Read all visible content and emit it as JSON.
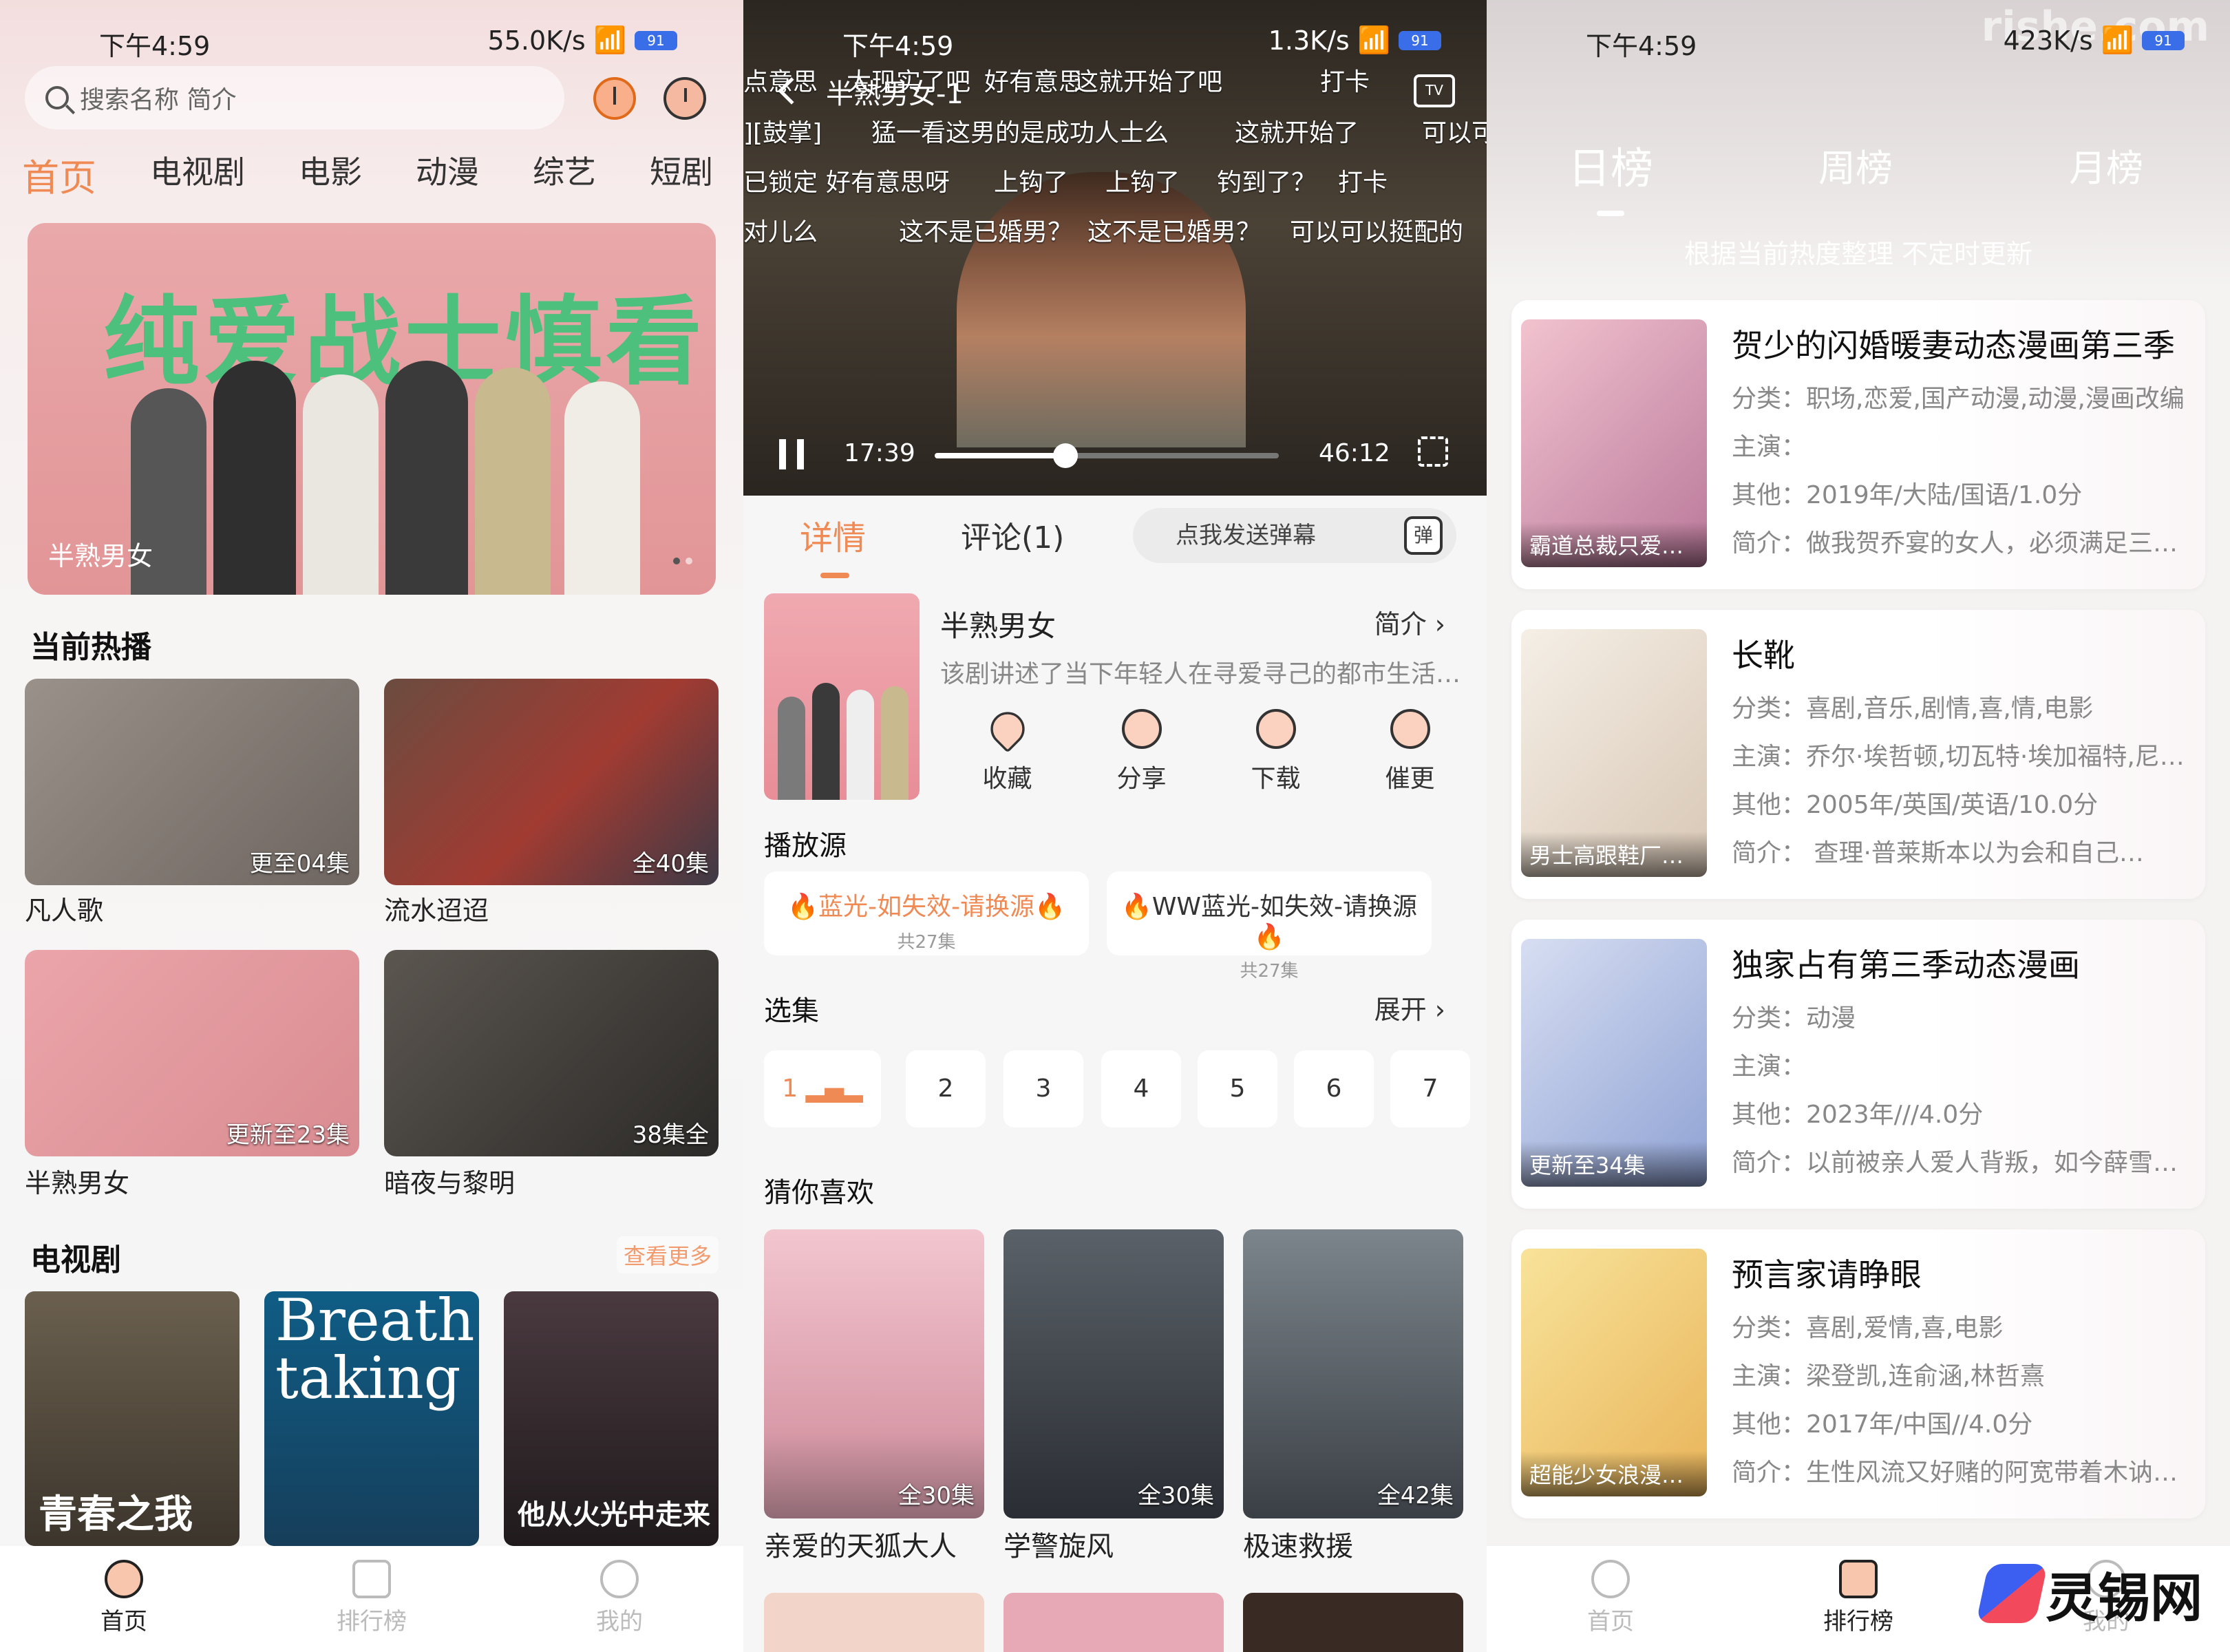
{
  "status": {
    "time": "下午4:59",
    "p1_net": "55.0K/s",
    "p2_net": "1.3K/s",
    "p3_net": "423K/s",
    "battery": "91"
  },
  "p1": {
    "search_placeholder": "搜索名称 简介",
    "tabs": [
      "首页",
      "电视剧",
      "电影",
      "动漫",
      "综艺",
      "短剧"
    ],
    "banner_overlay": "纯爱战士慎看",
    "banner_caption": "半熟男女",
    "hot_title": "当前热播",
    "hot": [
      {
        "title": "凡人歌",
        "badge": "更至04集",
        "color": "#8a7f78"
      },
      {
        "title": "流水迢迢",
        "badge": "全40集",
        "color": "#7a4a3c"
      },
      {
        "title": "半熟男女",
        "badge": "更新至23集",
        "color": "#e8a2a6"
      },
      {
        "title": "暗夜与黎明",
        "badge": "38集全",
        "color": "#4a4540"
      }
    ],
    "tv_title": "电视剧",
    "more": "查看更多",
    "posters": [
      {
        "color": "#5c5347",
        "text": "青春之我"
      },
      {
        "color": "#1e4f70",
        "text": "Breath taking"
      },
      {
        "color": "#3a2d33",
        "text": "他从火光中走来"
      }
    ],
    "nav": [
      "首页",
      "排行榜",
      "我的"
    ]
  },
  "p2": {
    "video_title": "半熟男女-1",
    "tv_label": "TV",
    "danmu": [
      "点意思",
      "太现实了吧",
      "好有意思",
      "这就开始了吧",
      "打卡",
      "][鼓掌]",
      "猛一看这男的是成功人士么",
      "这就开始了",
      "可以可",
      "已锁定",
      "好有意思呀",
      "上钩了",
      "上钩了",
      "钓到了？",
      "打卡",
      "对儿么",
      "这不是已婚男？",
      "这不是已婚男？",
      "可以可以挺配的"
    ],
    "current": "17:39",
    "duration": "46:12",
    "progress": 0.38,
    "tabs": [
      "详情",
      "评论(1)"
    ],
    "danmu_input": "点我发送弹幕",
    "danmu_btn": "弹",
    "title": "半熟男女",
    "intro": "简介",
    "desc": "该剧讲述了当下年轻人在寻爱寻己的都市生活…",
    "actions": [
      "收藏",
      "分享",
      "下载",
      "催更"
    ],
    "source_title": "播放源",
    "sources": [
      {
        "name": "🔥蓝光-如失效-请换源🔥",
        "count": "共27集"
      },
      {
        "name": "🔥WW蓝光-如失效-请换源🔥",
        "count": "共27集"
      }
    ],
    "episodes_title": "选集",
    "expand": "展开",
    "episodes": [
      "1",
      "2",
      "3",
      "4",
      "5",
      "6",
      "7"
    ],
    "rec_title": "猜你喜欢",
    "recs": [
      {
        "title": "亲爱的天狐大人",
        "badge": "全30集",
        "color": "#e9b4c0"
      },
      {
        "title": "学警旋风",
        "badge": "全30集",
        "color": "#3b4048"
      },
      {
        "title": "极速救援",
        "badge": "全42集",
        "color": "#4a5158"
      }
    ]
  },
  "p3": {
    "watermark": "rishe.com",
    "tabs": [
      "日榜",
      "周榜",
      "月榜"
    ],
    "note": "根据当前热度整理 不定时更新",
    "items": [
      {
        "name": "贺少的闪婚暖妻动态漫画第三季",
        "cat": "分类：职场,恋爱,国产动漫,动漫,漫画改编",
        "cast": "主演：",
        "other": "其他：2019年/大陆/国语/1.0分",
        "brief": "简介：做我贺乔宴的女人，必须满足三…",
        "cap": "霸道总裁只爱…",
        "color": "#e6a9b8"
      },
      {
        "name": "长靴",
        "cat": "分类：喜剧,音乐,剧情,喜,情,电影",
        "cast": "主演：乔尔·埃哲顿,切瓦特·埃加福特,尼…",
        "other": "其他：2005年/英国/英语/10.0分",
        "brief": "简介：        查理·普莱斯本以为会和自己…",
        "cap": "男士高跟鞋厂…",
        "color": "#efe6dc"
      },
      {
        "name": "独家占有第三季动态漫画",
        "cat": "分类：动漫",
        "cast": "主演：",
        "other": "其他：2023年///4.0分",
        "brief": "简介：以前被亲人爱人背叛，如今薛雪…",
        "cap": "更新至34集",
        "color": "#b8c6e8"
      },
      {
        "name": "预言家请睁眼",
        "cat": "分类：喜剧,爱情,喜,电影",
        "cast": "主演：梁登凯,连俞涵,林哲熹",
        "other": "其他：2017年/中国//4.0分",
        "brief": "简介：生性风流又好赌的阿宽带着木讷…",
        "cap": "超能少女浪漫…",
        "color": "#f3d27a"
      }
    ],
    "nav": [
      "首页",
      "排行榜",
      "我的"
    ],
    "logo": "灵锡网"
  }
}
